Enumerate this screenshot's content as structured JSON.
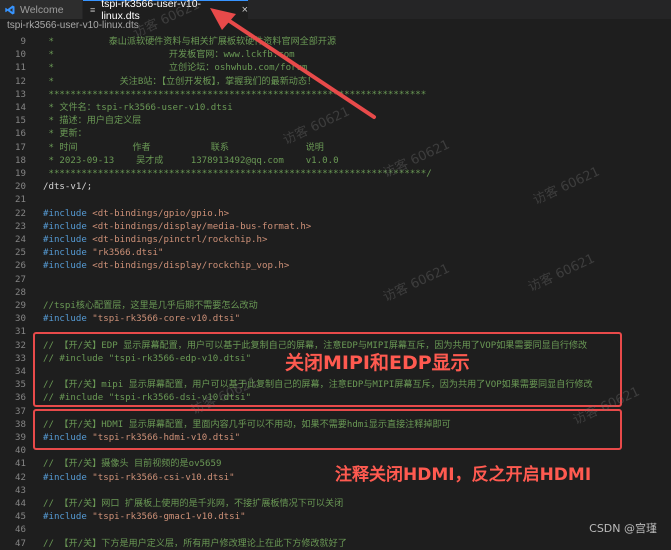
{
  "tabs": [
    {
      "label": "Welcome",
      "icon": "vscode-icon"
    },
    {
      "label": "tspi-rk3566-user-v10-linux.dts",
      "icon": "dts-file-icon",
      "close": "×"
    }
  ],
  "breadcrumb": "tspi-rk3566-user-v10-linux.dts",
  "dts_icon_glyph": "≡",
  "lines": [
    {
      "n": "9",
      "t": [
        {
          "c": "c-comment",
          "s": " *          泰山派软硬件资料与相关扩展板软硬件资料官网全部开源"
        }
      ]
    },
    {
      "n": "10",
      "t": [
        {
          "c": "c-comment",
          "s": " *                     开发板官网：www.lckfb.com"
        }
      ]
    },
    {
      "n": "11",
      "t": [
        {
          "c": "c-comment",
          "s": " *                     立创论坛：oshwhub.com/forum"
        }
      ]
    },
    {
      "n": "12",
      "t": [
        {
          "c": "c-comment",
          "s": " *            关注B站：【立创开发板】，掌握我们的最新动态！"
        }
      ]
    },
    {
      "n": "13",
      "t": [
        {
          "c": "c-comment",
          "s": " *********************************************************************"
        }
      ]
    },
    {
      "n": "14",
      "t": [
        {
          "c": "c-comment",
          "s": " * 文件名：tspi-rk3566-user-v10.dtsi"
        }
      ]
    },
    {
      "n": "15",
      "t": [
        {
          "c": "c-comment",
          "s": " * 描述：用户自定义层"
        }
      ]
    },
    {
      "n": "16",
      "t": [
        {
          "c": "c-comment",
          "s": " * 更新："
        }
      ]
    },
    {
      "n": "17",
      "t": [
        {
          "c": "c-comment",
          "s": " * 时间          作者           联系              说明"
        }
      ]
    },
    {
      "n": "18",
      "t": [
        {
          "c": "c-comment",
          "s": " * 2023-09-13    吴才成     1378913492@qq.com    v1.0.0"
        }
      ]
    },
    {
      "n": "19",
      "t": [
        {
          "c": "c-comment",
          "s": " *********************************************************************/"
        }
      ]
    },
    {
      "n": "20",
      "t": [
        {
          "c": "c-plain",
          "s": "/dts-v1/;"
        }
      ]
    },
    {
      "n": "21",
      "t": []
    },
    {
      "n": "22",
      "t": [
        {
          "c": "c-kw",
          "s": "#include "
        },
        {
          "c": "c-str",
          "s": "<dt-bindings/gpio/gpio.h>"
        }
      ]
    },
    {
      "n": "23",
      "t": [
        {
          "c": "c-kw",
          "s": "#include "
        },
        {
          "c": "c-str",
          "s": "<dt-bindings/display/media-bus-format.h>"
        }
      ]
    },
    {
      "n": "24",
      "t": [
        {
          "c": "c-kw",
          "s": "#include "
        },
        {
          "c": "c-str",
          "s": "<dt-bindings/pinctrl/rockchip.h>"
        }
      ]
    },
    {
      "n": "25",
      "t": [
        {
          "c": "c-kw",
          "s": "#include "
        },
        {
          "c": "c-str",
          "s": "\"rk3566.dtsi\""
        }
      ]
    },
    {
      "n": "26",
      "t": [
        {
          "c": "c-kw",
          "s": "#include "
        },
        {
          "c": "c-str",
          "s": "<dt-bindings/display/rockchip_vop.h>"
        }
      ]
    },
    {
      "n": "27",
      "t": []
    },
    {
      "n": "28",
      "t": []
    },
    {
      "n": "29",
      "t": [
        {
          "c": "c-comment",
          "s": "//tspi核心配置层，这里是几乎后期不需要怎么改动"
        }
      ]
    },
    {
      "n": "30",
      "t": [
        {
          "c": "c-kw",
          "s": "#include "
        },
        {
          "c": "c-str",
          "s": "\"tspi-rk3566-core-v10.dtsi\""
        }
      ]
    },
    {
      "n": "31",
      "t": []
    },
    {
      "n": "32",
      "t": [
        {
          "c": "c-comment",
          "s": "// 【开/关】EDP 显示屏幕配置，用户可以基于此复制自己的屏幕，注意EDP与MIPI屏幕互斥，因为共用了VOP如果需要同显自行修改"
        }
      ]
    },
    {
      "n": "33",
      "t": [
        {
          "c": "c-comment",
          "s": "// #include \"tspi-rk3566-edp-v10.dtsi\""
        }
      ]
    },
    {
      "n": "34",
      "t": []
    },
    {
      "n": "35",
      "t": [
        {
          "c": "c-comment",
          "s": "// 【开/关】mipi 显示屏幕配置，用户可以基于此复制自己的屏幕，注意EDP与MIPI屏幕互斥，因为共用了VOP如果需要同显自行修改"
        }
      ]
    },
    {
      "n": "36",
      "t": [
        {
          "c": "c-comment",
          "s": "// #include \"tspi-rk3566-dsi-v10.dtsi\""
        }
      ]
    },
    {
      "n": "37",
      "t": []
    },
    {
      "n": "38",
      "t": [
        {
          "c": "c-comment",
          "s": "// 【开/关】HDMI 显示屏幕配置，里面内容几乎可以不用动，如果不需要hdmi显示直接注释掉即可"
        }
      ]
    },
    {
      "n": "39",
      "t": [
        {
          "c": "c-kw",
          "s": "#include "
        },
        {
          "c": "c-str",
          "s": "\"tspi-rk3566-hdmi-v10.dtsi\""
        }
      ]
    },
    {
      "n": "40",
      "t": []
    },
    {
      "n": "41",
      "t": [
        {
          "c": "c-comment",
          "s": "// 【开/关】摄像头 目前视频的是ov5659"
        }
      ]
    },
    {
      "n": "42",
      "t": [
        {
          "c": "c-kw",
          "s": "#include "
        },
        {
          "c": "c-str",
          "s": "\"tspi-rk3566-csi-v10.dtsi\""
        }
      ]
    },
    {
      "n": "43",
      "t": []
    },
    {
      "n": "44",
      "t": [
        {
          "c": "c-comment",
          "s": "// 【开/关】网口 扩展板上使用的是千兆网，不接扩展板情况下可以关闭"
        }
      ]
    },
    {
      "n": "45",
      "t": [
        {
          "c": "c-kw",
          "s": "#include "
        },
        {
          "c": "c-str",
          "s": "\"tspi-rk3566-gmac1-v10.dtsi\""
        }
      ]
    },
    {
      "n": "46",
      "t": []
    },
    {
      "n": "47",
      "t": [
        {
          "c": "c-comment",
          "s": "// 【开/关】下方是用户定义层，所有用户修改理论上在此下方修改就好了"
        }
      ]
    }
  ],
  "annotations": {
    "mipi_edp": "关闭MIPI和EDP显示",
    "hdmi": "注释关闭HDMI，反之开启HDMI"
  },
  "watermarks": [
    "访客 60621",
    "访客 60621",
    "访客 60621",
    "访客 60621",
    "访客 60621",
    "访客 60621",
    "访客 60621",
    "访客 60621"
  ],
  "footer": "CSDN @宫瑾",
  "colors": {
    "annotation_red": "#ff5a50",
    "box_red": "#e84a4a",
    "tab_accent": "#3794ff"
  }
}
